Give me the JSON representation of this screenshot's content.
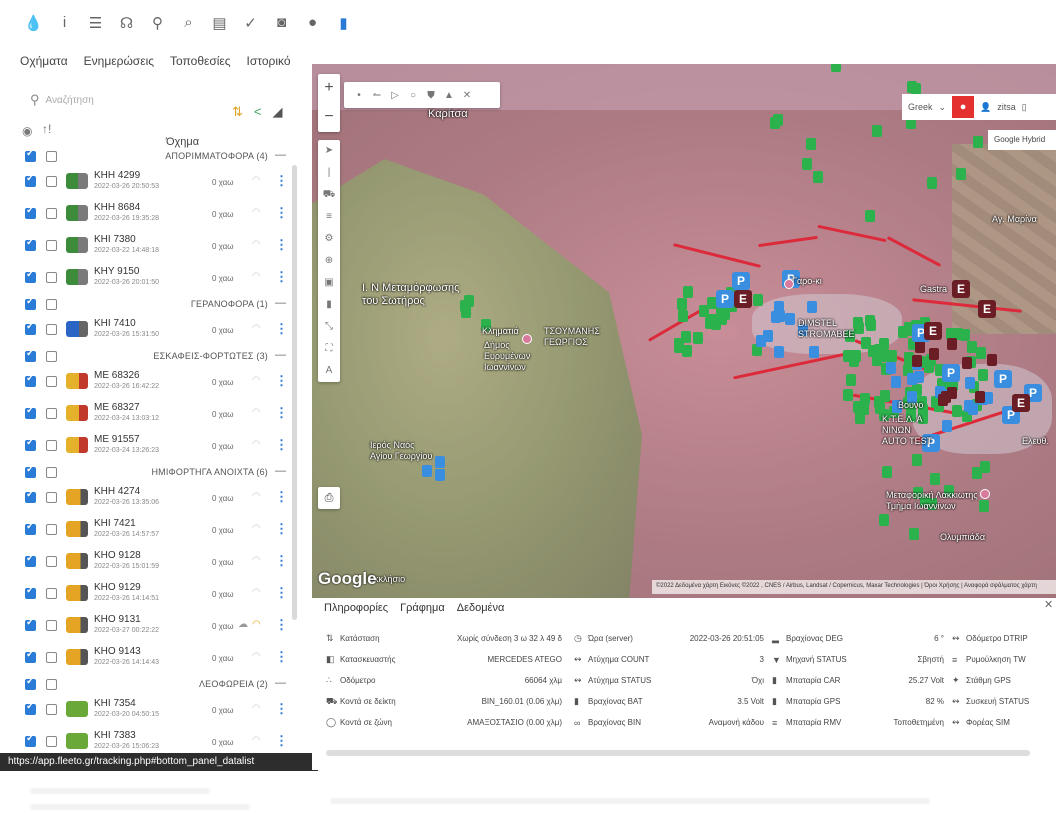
{
  "top_icons": [
    "drop-icon",
    "info-icon",
    "sliders-icon",
    "headset-icon",
    "pin-icon",
    "search-icon",
    "chart-icon",
    "check-icon",
    "camera-icon",
    "chat-icon",
    "phone-icon"
  ],
  "nav_tabs": [
    "Οχήματα",
    "Ενημερώσεις",
    "Τοποθεσίες",
    "Ιστορικό"
  ],
  "search": {
    "placeholder": "Αναζήτηση"
  },
  "list_header": {
    "title": "Όχημα"
  },
  "groups": [
    {
      "name": "ΑΠΟΡΙΜΜΑΤΟΦΟΡΑ (4)",
      "vehicles": [
        {
          "plate": "KHH 4299",
          "date": "2022-03-26 20:50:53",
          "speed": "0 χαω",
          "icon": "truck"
        },
        {
          "plate": "KHH 8684",
          "date": "2022-03-26 19:35:28",
          "speed": "0 χαω",
          "icon": "truck"
        },
        {
          "plate": "KHI 7380",
          "date": "2022-03-22 14:48:18",
          "speed": "0 χαω",
          "icon": "truck"
        },
        {
          "plate": "KHY 9150",
          "date": "2022-03-26 20:01:50",
          "speed": "0 χαω",
          "icon": "truck"
        }
      ]
    },
    {
      "name": "ΓΕΡΑΝΟΦΟΡΑ (1)",
      "vehicles": [
        {
          "plate": "KHI 7410",
          "date": "2022-03-26 15:31:50",
          "speed": "0 χαω",
          "icon": "crane"
        }
      ]
    },
    {
      "name": "ΕΣΚΑΦΕΙΣ-ΦΟΡΤΩΤΕΣ (3)",
      "vehicles": [
        {
          "plate": "ME 68326",
          "date": "2022-03-26 16:42:22",
          "speed": "0 χαω",
          "icon": "exc"
        },
        {
          "plate": "ME 68327",
          "date": "2022-03-24 13:03:12",
          "speed": "0 χαω",
          "icon": "exc"
        },
        {
          "plate": "ME 91557",
          "date": "2022-03-24 13:26:23",
          "speed": "0 χαω",
          "icon": "exc"
        }
      ]
    },
    {
      "name": "ΗΜΙΦΟΡΤΗΓΑ ΑΝΟΙΧΤΑ (6)",
      "vehicles": [
        {
          "plate": "KHH 4274",
          "date": "2022-03-26 13:35:06",
          "speed": "0 χαω",
          "icon": "trailer"
        },
        {
          "plate": "KHI 7421",
          "date": "2022-03-26 14:57:57",
          "speed": "0 χαω",
          "icon": "trailer"
        },
        {
          "plate": "KHO 9128",
          "date": "2022-03-26 15:01:59",
          "speed": "0 χαω",
          "icon": "trailer"
        },
        {
          "plate": "KHO 9129",
          "date": "2022-03-26 14:14:51",
          "speed": "0 χαω",
          "icon": "trailer"
        },
        {
          "plate": "KHO 9131",
          "date": "2022-03-27 00:22:22",
          "speed": "0 χαω",
          "icon": "trailer",
          "cloud": true,
          "lit": true
        },
        {
          "plate": "KHO 9143",
          "date": "2022-03-26 14:14:43",
          "speed": "0 χαω",
          "icon": "trailer"
        }
      ]
    },
    {
      "name": "ΛΕΟΦΩΡΕΙΑ (2)",
      "vehicles": [
        {
          "plate": "KHI 7354",
          "date": "2022-03-20 04:50:15",
          "speed": "0 χαω",
          "icon": "bus"
        },
        {
          "plate": "KHI 7383",
          "date": "2022-03-26 15:06:23",
          "speed": "0 χαω",
          "icon": "bus"
        }
      ]
    }
  ],
  "status_url": "https://app.fleeto.gr/tracking.php#bottom_panel_datalist",
  "map": {
    "language": "Greek",
    "user": "zitsa",
    "map_type": "Google Hybrid",
    "google_logo": "Google",
    "attribution": "©2022 Δεδομένα χάρτη Εικόνες ©2022 , CNES / Airbus, Landsat / Copernicus, Maxar Technologies | Όροι Χρήσης | Αναφορά σφάλματος χάρτη",
    "labels": {
      "karitsa": "Καρίτσα",
      "metamorfosi": "Ι. Ν Μεταμόρφωσης\nτου Σωτήρος",
      "klimatia": "Κληματιά",
      "dimos": "Δήμος\nΕυρυμένων\nΙωαννίνων",
      "tsoumanis": "ΤΣΟΥΜΑΝΗΣ\nΓΕΩΡΓΙΟΣ",
      "ieros": "Ιερός Ναός\nΑγίου Γεωργίου",
      "dimstel": "DIMSTEL\nSTROMABEE",
      "paroikos": "Γαρο-κι",
      "kastro": "Gastra",
      "ktel": "Κ.Τ.Ε.Λ. Α\nΝΙΝΩΝ\nAUTO TEST",
      "bouno": "Βουνο",
      "metaforiki": "Μεταφορική Λακκιωτης\nΤμήμα Ιωαννίνων",
      "olympiada": "Ολυμπιάδα",
      "ekklisio": "Εκκλήσιο",
      "agmarina": "Αγ. Μαρίνα",
      "elefth": "Ελευθ.",
      "lamproni": "Λαμπρ-"
    }
  },
  "bottom_panel": {
    "tabs": [
      "Πληροφορίες",
      "Γράφημα",
      "Δεδομένα"
    ],
    "col1_labels": [
      "Κατάσταση",
      "Κατασκευαστής",
      "Οδόμετρο",
      "Κοντά σε δείκτη",
      "Κοντά σε ζώνη"
    ],
    "col1_values": [
      "Χωρίς σύνδεση 3 ω 32 λ 49 δ",
      "MERCEDES ATEGO",
      "66064 χλμ",
      "BIN_160.01 (0.06 χλμ)",
      "ΑΜΑΞΟΣΤΑΣΙΟ (0.00 χλμ)"
    ],
    "col2_labels": [
      "Ώρα (server)",
      "Ατύχημα COUNT",
      "Ατύχημα STATUS",
      "Βραχίονας BAT",
      "Βραχίονας BIN"
    ],
    "col2_values": [
      "2022-03-26 20:51:05",
      "3",
      "Όχι",
      "3.5 Volt",
      "Αναμονή κάδου"
    ],
    "col3_labels": [
      "Βραχίονας DEG",
      "Μηχανή STATUS",
      "Μπαταρία CAR",
      "Μπαταρία GPS",
      "Μπαταρία RMV"
    ],
    "col3_values": [
      "6 °",
      "Σβηστή",
      "25.27 Volt",
      "82 %",
      "Τοποθετημένη"
    ],
    "col4_labels": [
      "Οδόμετρο DTRIP",
      "Ρυμούλκηση TW",
      "Στάθμη GPS",
      "Συσκευή STATUS",
      "Φορέας SIM"
    ]
  },
  "colors": {
    "accent": "#2a7bd6",
    "route": "#dc2a3a",
    "alert": "#e53030"
  }
}
